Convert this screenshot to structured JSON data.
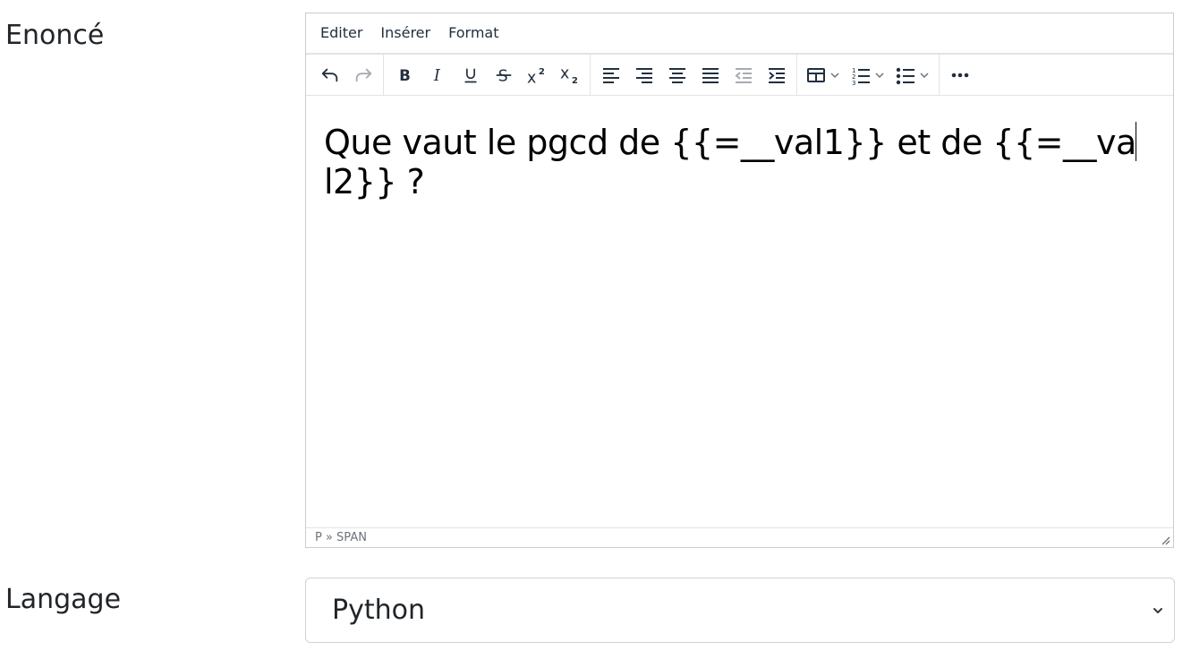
{
  "form": {
    "statement_label": "Enoncé",
    "language_label": "Langage"
  },
  "editor": {
    "menu": [
      "Editer",
      "Insérer",
      "Format"
    ],
    "toolbar_icons": [
      "undo-icon",
      "redo-icon",
      "bold-icon",
      "italic-icon",
      "underline-icon",
      "strikethrough-icon",
      "superscript-icon",
      "subscript-icon",
      "align-left-icon",
      "align-right-icon",
      "align-center-icon",
      "align-justify-icon",
      "outdent-icon",
      "indent-icon",
      "table-icon",
      "numbered-list-icon",
      "bullet-list-icon",
      "more-icon"
    ],
    "content_before_caret": "Que vaut le pgcd de {{=__val1}} et de {{=__va",
    "content_after_caret": "l2}} ?",
    "status_path": "P » SPAN"
  },
  "language_select": {
    "selected": "Python"
  }
}
